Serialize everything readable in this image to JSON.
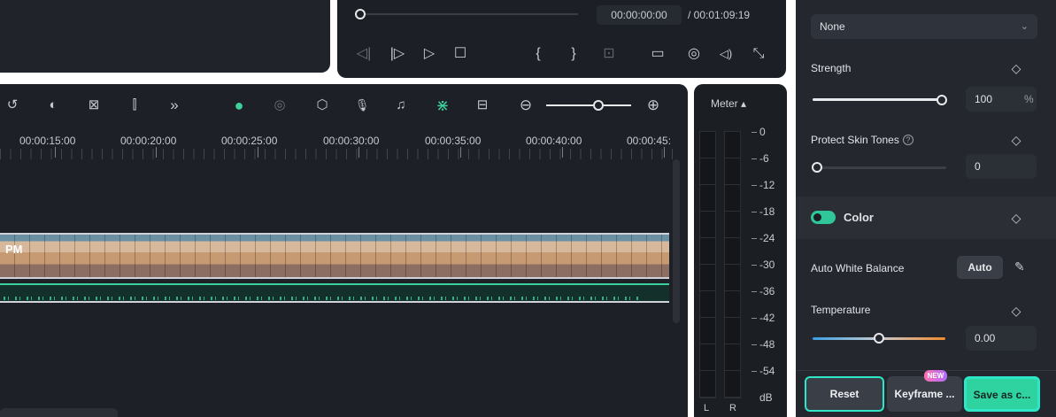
{
  "player": {
    "current_time": "00:00:00:00",
    "total_time": "/ 00:01:09:19",
    "controls": {
      "prev_frame": "◁|",
      "next_frame": "|▷",
      "play": "▷",
      "stop": "☐",
      "mark_in": "{",
      "mark_out": "}",
      "render": "⊡",
      "display": "▭",
      "snapshot": "◎",
      "volume": "◁)",
      "fullscreen": "⤡"
    }
  },
  "timeline": {
    "toolbar": {
      "history": "↺",
      "palette": "◐",
      "marker_tool": "⊠",
      "split": "⫿",
      "more": "»",
      "ai_avatar": "●",
      "play_circle": "◎",
      "shield": "⬡",
      "mic": "🎙",
      "music": "♫",
      "snap": "⋇",
      "fit": "⊟",
      "zoom_out": "⊖",
      "zoom_in": "⊕"
    },
    "ruler": [
      "00:00:15:00",
      "00:00:20:00",
      "00:00:25:00",
      "00:00:30:00",
      "00:00:35:00",
      "00:00:40:00",
      "00:00:45:"
    ],
    "clip_label": "PM"
  },
  "meter": {
    "title": "Meter ▴",
    "scale": [
      "0",
      "-6",
      "-12",
      "-18",
      "-24",
      "-30",
      "-36",
      "-42",
      "-48",
      "-54",
      "dB"
    ],
    "left_channel": "L",
    "right_channel": "R"
  },
  "properties": {
    "preset_value": "None",
    "strength": {
      "label": "Strength",
      "value": "100",
      "unit": "%",
      "level": 1.0
    },
    "skin_tones": {
      "label": "Protect Skin Tones",
      "help": "?",
      "value": "0",
      "level": 0.0
    },
    "color_section": {
      "label": "Color",
      "enabled": true
    },
    "white_balance": {
      "label": "Auto White Balance",
      "button": "Auto",
      "picker_icon": "✎"
    },
    "temperature": {
      "label": "Temperature",
      "value": "0.00",
      "level": 0.5
    },
    "keyframe_icon": "◇",
    "colors": {
      "accent": "#2fd3a0",
      "highlight_border": "#2ee6c8",
      "temp_cool": "#3aa0e0",
      "temp_warm": "#f08a2c"
    }
  },
  "footer": {
    "reset": "Reset",
    "keyframe": "Keyframe ...",
    "new_badge": "NEW",
    "save": "Save as c..."
  }
}
